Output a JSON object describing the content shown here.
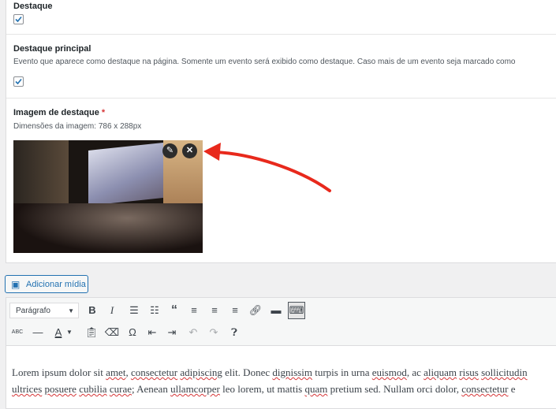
{
  "fields": {
    "destaque": {
      "label": "Destaque",
      "checked": true
    },
    "destaque_principal": {
      "label": "Destaque principal",
      "description": "Evento que aparece como destaque na página. Somente um evento será exibido como destaque. Caso mais de um evento seja marcado como",
      "checked": true
    },
    "imagem": {
      "label": "Imagem de destaque",
      "required": "*",
      "description": "Dimensões da imagem: 786 x 288px",
      "edit_icon": "pencil-icon",
      "remove_icon": "close-icon"
    }
  },
  "media_button": {
    "label": "Adicionar mídia"
  },
  "editor": {
    "format_select": "Parágrafo",
    "content": {
      "line1": [
        "Lorem ipsum dolor sit ",
        "amet",
        ", ",
        "consectetur",
        " ",
        "adipiscing",
        " elit. Donec ",
        "dignissim",
        " turpis in urna ",
        "euismod",
        ", ac ",
        "aliquam",
        " ",
        "risus",
        " ",
        "sollicitudin"
      ],
      "line2": [
        "ultrices",
        " ",
        "posuere",
        " ",
        "cubilia",
        " ",
        "curae",
        "; Aenean ",
        "ullamcorper",
        " leo lorem, ut mattis ",
        "quam",
        " pretium sed. Nullam orci dolor, ",
        "consectetur",
        " e"
      ]
    }
  },
  "colors": {
    "accent": "#2271b1",
    "annotation_arrow": "#e8291c"
  }
}
